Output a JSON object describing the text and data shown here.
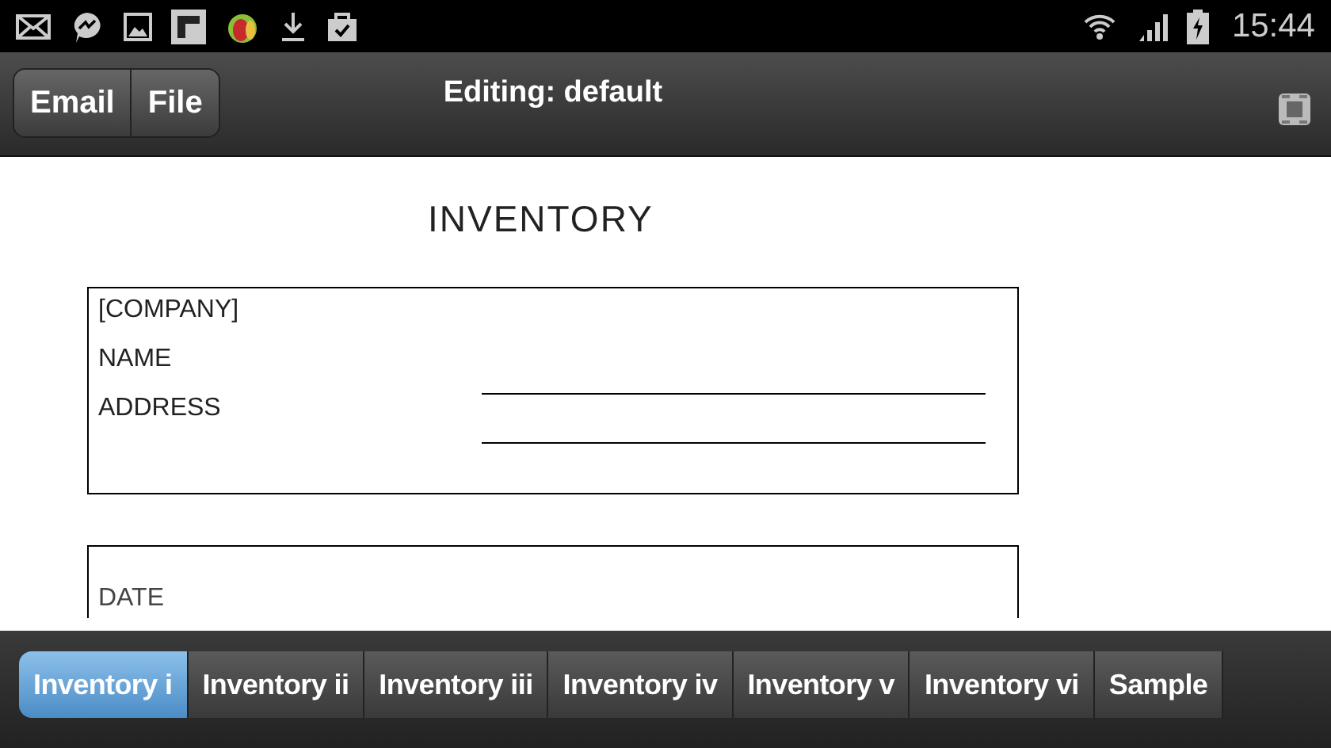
{
  "status_bar": {
    "time": "15:44"
  },
  "toolbar": {
    "buttons": [
      {
        "label": "Email"
      },
      {
        "label": "File"
      }
    ],
    "title": "Editing: default"
  },
  "document": {
    "title": "INVENTORY",
    "company_box": {
      "fields": [
        {
          "label": "[COMPANY]",
          "kind": "plain"
        },
        {
          "label": "NAME",
          "kind": "line"
        },
        {
          "label": "ADDRESS",
          "kind": "line"
        }
      ]
    },
    "date_box": {
      "label": "DATE"
    }
  },
  "tabs": [
    {
      "label": "Inventory i",
      "selected": true
    },
    {
      "label": "Inventory ii",
      "selected": false
    },
    {
      "label": "Inventory iii",
      "selected": false
    },
    {
      "label": "Inventory iv",
      "selected": false
    },
    {
      "label": "Inventory v",
      "selected": false
    },
    {
      "label": "Inventory vi",
      "selected": false
    },
    {
      "label": "Sample",
      "selected": false
    }
  ]
}
